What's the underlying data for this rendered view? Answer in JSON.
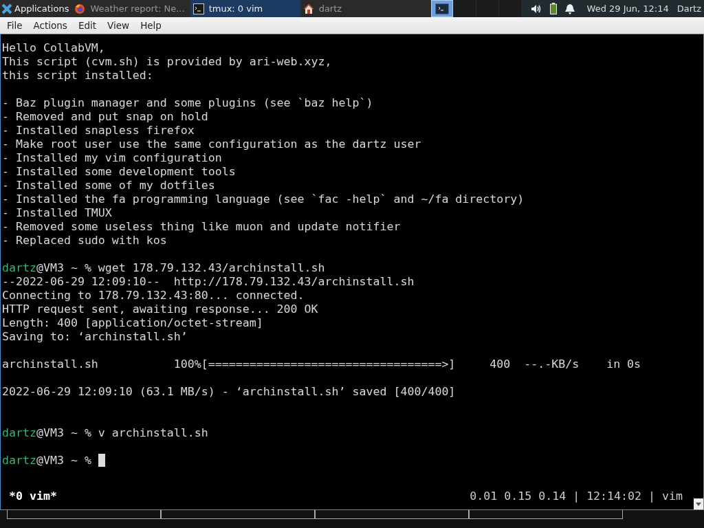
{
  "taskbar": {
    "menu_label": "Applications",
    "tasks": [
      {
        "label": "Weather report: Ne...",
        "kind": "browser",
        "selected": false
      },
      {
        "label": "tmux: 0 vim",
        "kind": "terminal",
        "selected": true
      },
      {
        "label": "dartz",
        "kind": "folder",
        "selected": false
      }
    ],
    "workspaces": [
      {
        "selected": true
      },
      {
        "selected": false
      },
      {
        "selected": false
      },
      {
        "selected": false
      }
    ],
    "clock": "Wed 29 Jun, 12:14",
    "user": "Dartz"
  },
  "menubar": [
    "File",
    "Actions",
    "Edit",
    "View",
    "Help"
  ],
  "terminal": {
    "lines": [
      {
        "kind": "text",
        "text": "Hello CollabVM,"
      },
      {
        "kind": "text",
        "text": "This script (cvm.sh) is provided by ari-web.xyz,"
      },
      {
        "kind": "text",
        "text": "this script installed:"
      },
      {
        "kind": "blank"
      },
      {
        "kind": "text",
        "text": "- Baz plugin manager and some plugins (see `baz help`)"
      },
      {
        "kind": "text",
        "text": "- Removed and put snap on hold"
      },
      {
        "kind": "text",
        "text": "- Installed snapless firefox"
      },
      {
        "kind": "text",
        "text": "- Make root user use the same configuration as the dartz user"
      },
      {
        "kind": "text",
        "text": "- Installed my vim configuration"
      },
      {
        "kind": "text",
        "text": "- Installed some development tools"
      },
      {
        "kind": "text",
        "text": "- Installed some of my dotfiles"
      },
      {
        "kind": "text",
        "text": "- Installed the fa programming language (see `fac -help` and ~/fa directory)"
      },
      {
        "kind": "text",
        "text": "- Installed TMUX"
      },
      {
        "kind": "text",
        "text": "- Removed some useless thing like muon and update notifier"
      },
      {
        "kind": "text",
        "text": "- Replaced sudo with kos"
      },
      {
        "kind": "blank"
      },
      {
        "kind": "prompt",
        "user": "dartz",
        "rest": "@VM3 ~ % wget 178.79.132.43/archinstall.sh"
      },
      {
        "kind": "text",
        "text": "--2022-06-29 12:09:10--  http://178.79.132.43/archinstall.sh"
      },
      {
        "kind": "text",
        "text": "Connecting to 178.79.132.43:80... connected."
      },
      {
        "kind": "text",
        "text": "HTTP request sent, awaiting response... 200 OK"
      },
      {
        "kind": "text",
        "text": "Length: 400 [application/octet-stream]"
      },
      {
        "kind": "text",
        "text": "Saving to: ‘archinstall.sh’"
      },
      {
        "kind": "blank"
      },
      {
        "kind": "text",
        "text": "archinstall.sh           100%[==================================>]     400  --.-KB/s    in 0s"
      },
      {
        "kind": "blank"
      },
      {
        "kind": "text",
        "text": "2022-06-29 12:09:10 (63.1 MB/s) - ‘archinstall.sh’ saved [400/400]"
      },
      {
        "kind": "blank"
      },
      {
        "kind": "blank"
      },
      {
        "kind": "prompt",
        "user": "dartz",
        "rest": "@VM3 ~ % v archinstall.sh"
      },
      {
        "kind": "blank"
      },
      {
        "kind": "prompt",
        "user": "dartz",
        "rest": "@VM3 ~ % ",
        "cursor": true
      }
    ],
    "status_left": "*0 vim*",
    "status_right": "0.01 0.15 0.14 | 12:14:02 | vim"
  }
}
